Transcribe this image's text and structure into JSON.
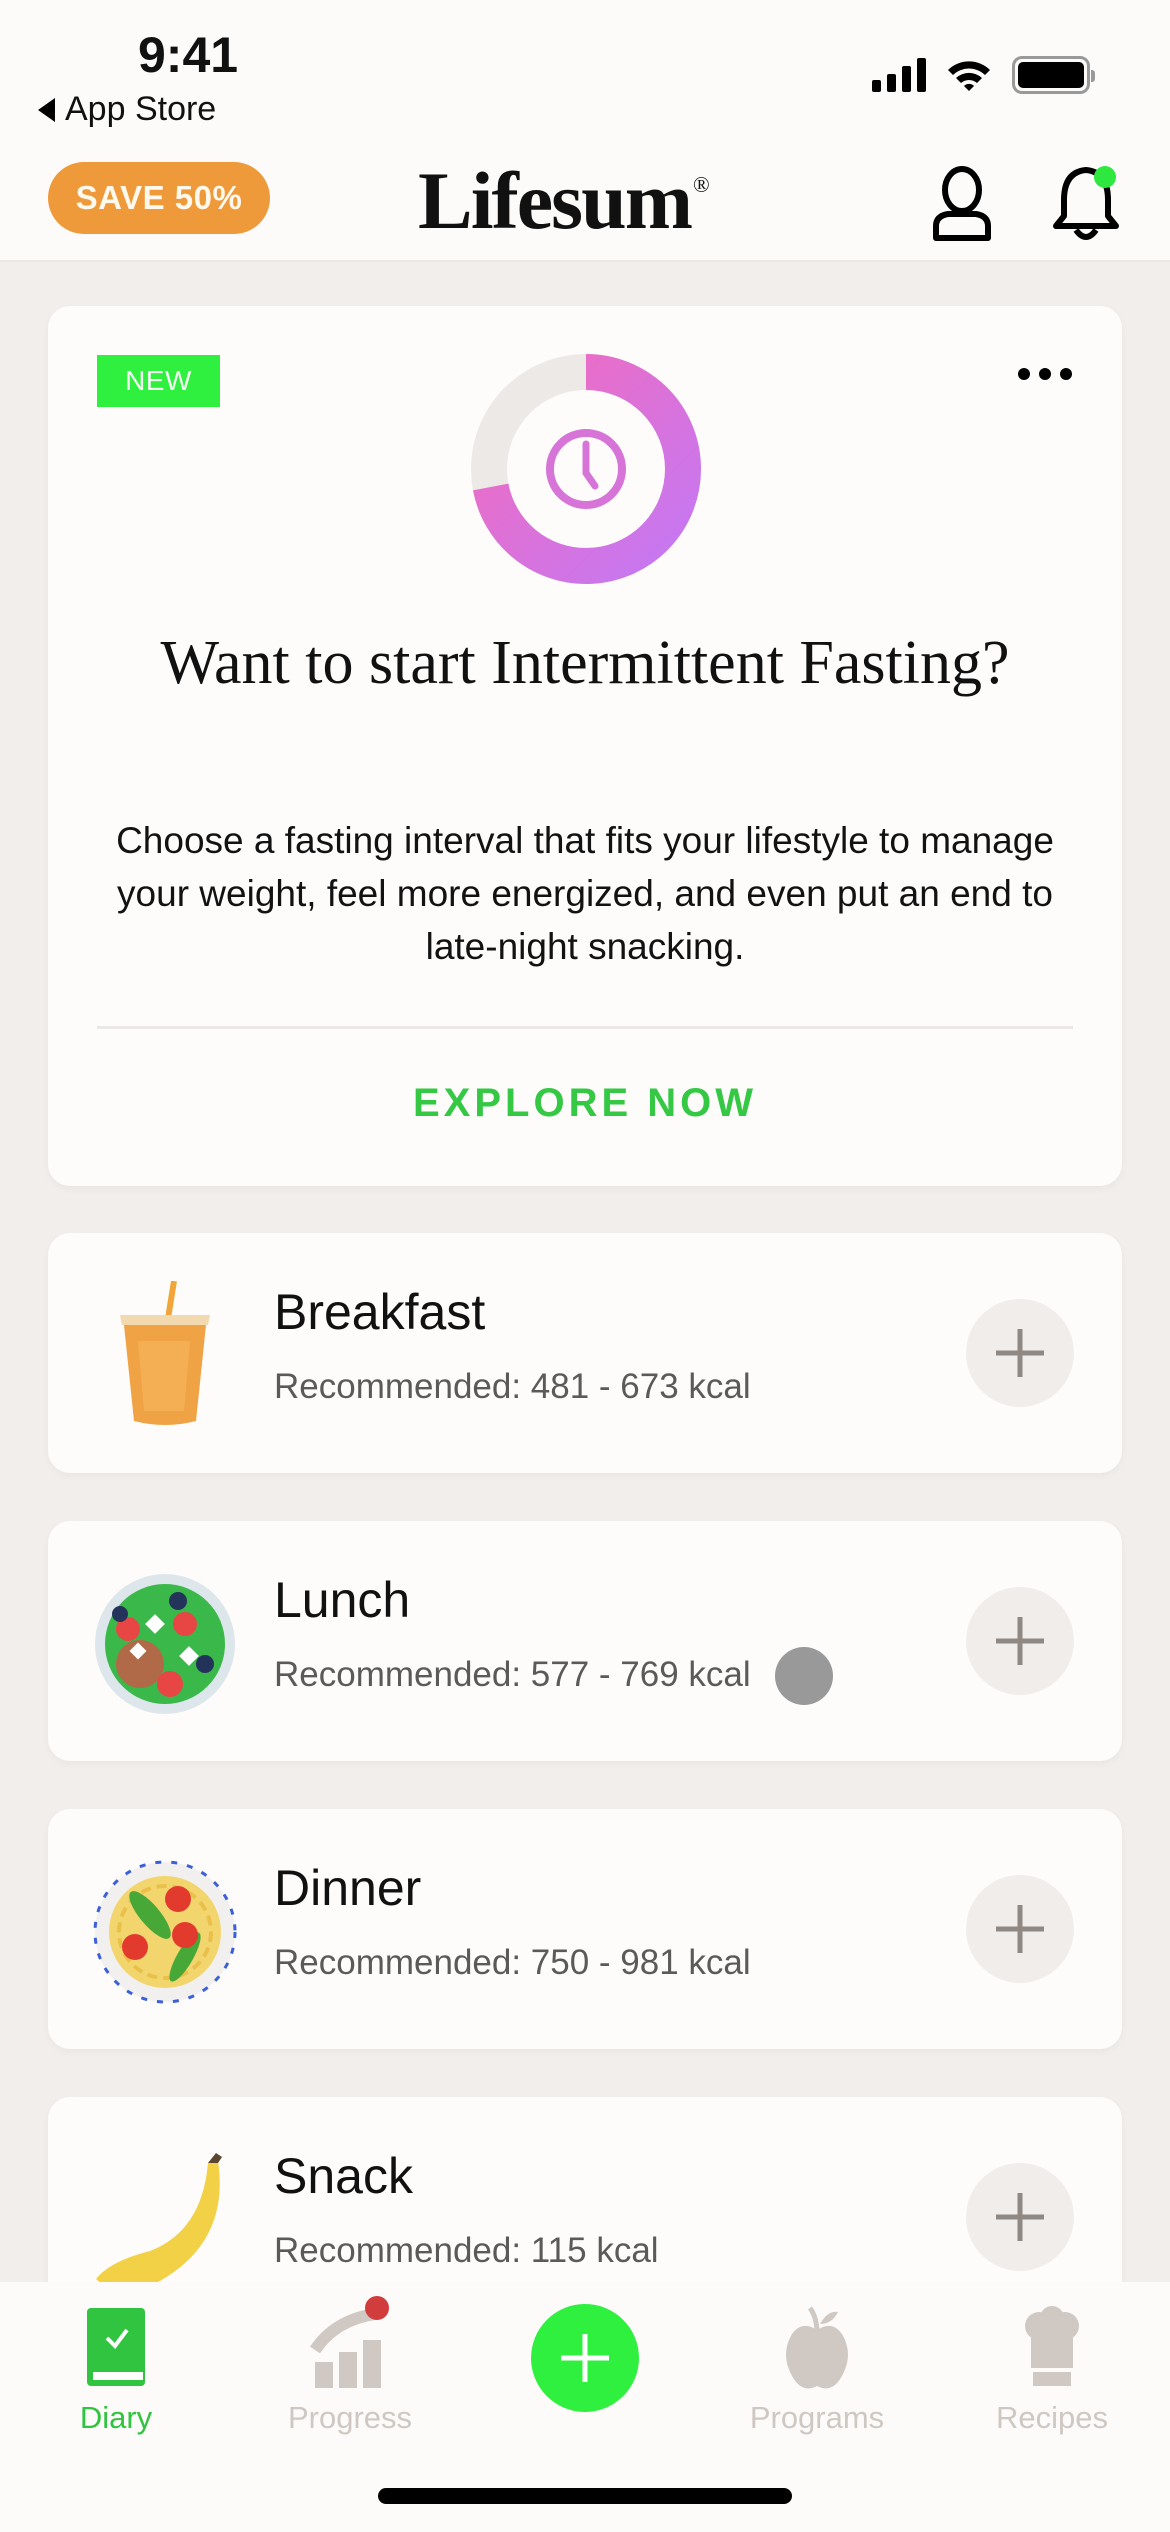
{
  "status_bar": {
    "time": "9:41",
    "back_label": "App Store"
  },
  "header": {
    "promo_label": "SAVE 50%",
    "logo": "Lifesum",
    "logo_mark": "®",
    "profile_icon": "person-icon",
    "notifications_icon": "bell-icon",
    "notification_dot_color": "#2fe83f"
  },
  "fasting_card": {
    "badge": "NEW",
    "title": "Want to start Intermittent Fasting?",
    "body": "Choose a fasting interval that fits your lifestyle to manage your weight, feel more energized, and even put an end to late-night snacking.",
    "cta": "EXPLORE NOW",
    "ring_progress": 0.72,
    "colors": {
      "ring_start": "#f26bbd",
      "ring_end": "#c478f4",
      "cta": "#34c844",
      "badge": "#2ff03f"
    }
  },
  "meals": [
    {
      "name": "Breakfast",
      "recommendation": "Recommended: 481 - 673  kcal",
      "image": "iced-drink"
    },
    {
      "name": "Lunch",
      "recommendation": "Recommended: 577 - 769  kcal",
      "image": "salad-bowl"
    },
    {
      "name": "Dinner",
      "recommendation": "Recommended: 750 - 981  kcal",
      "image": "pasta-plate"
    },
    {
      "name": "Snack",
      "recommendation": "Recommended: 115  kcal",
      "image": "banana"
    }
  ],
  "tabbar": {
    "items": [
      {
        "label": "Diary",
        "icon": "diary-book-icon",
        "active": true
      },
      {
        "label": "Progress",
        "icon": "progress-chart-icon",
        "active": false,
        "has_badge": true
      },
      {
        "label": "",
        "icon": "plus-icon",
        "active": false
      },
      {
        "label": "Programs",
        "icon": "apple-icon",
        "active": false
      },
      {
        "label": "Recipes",
        "icon": "chef-hat-icon",
        "active": false
      }
    ],
    "active_color": "#30c440",
    "inactive_color": "#cfc8c2"
  }
}
